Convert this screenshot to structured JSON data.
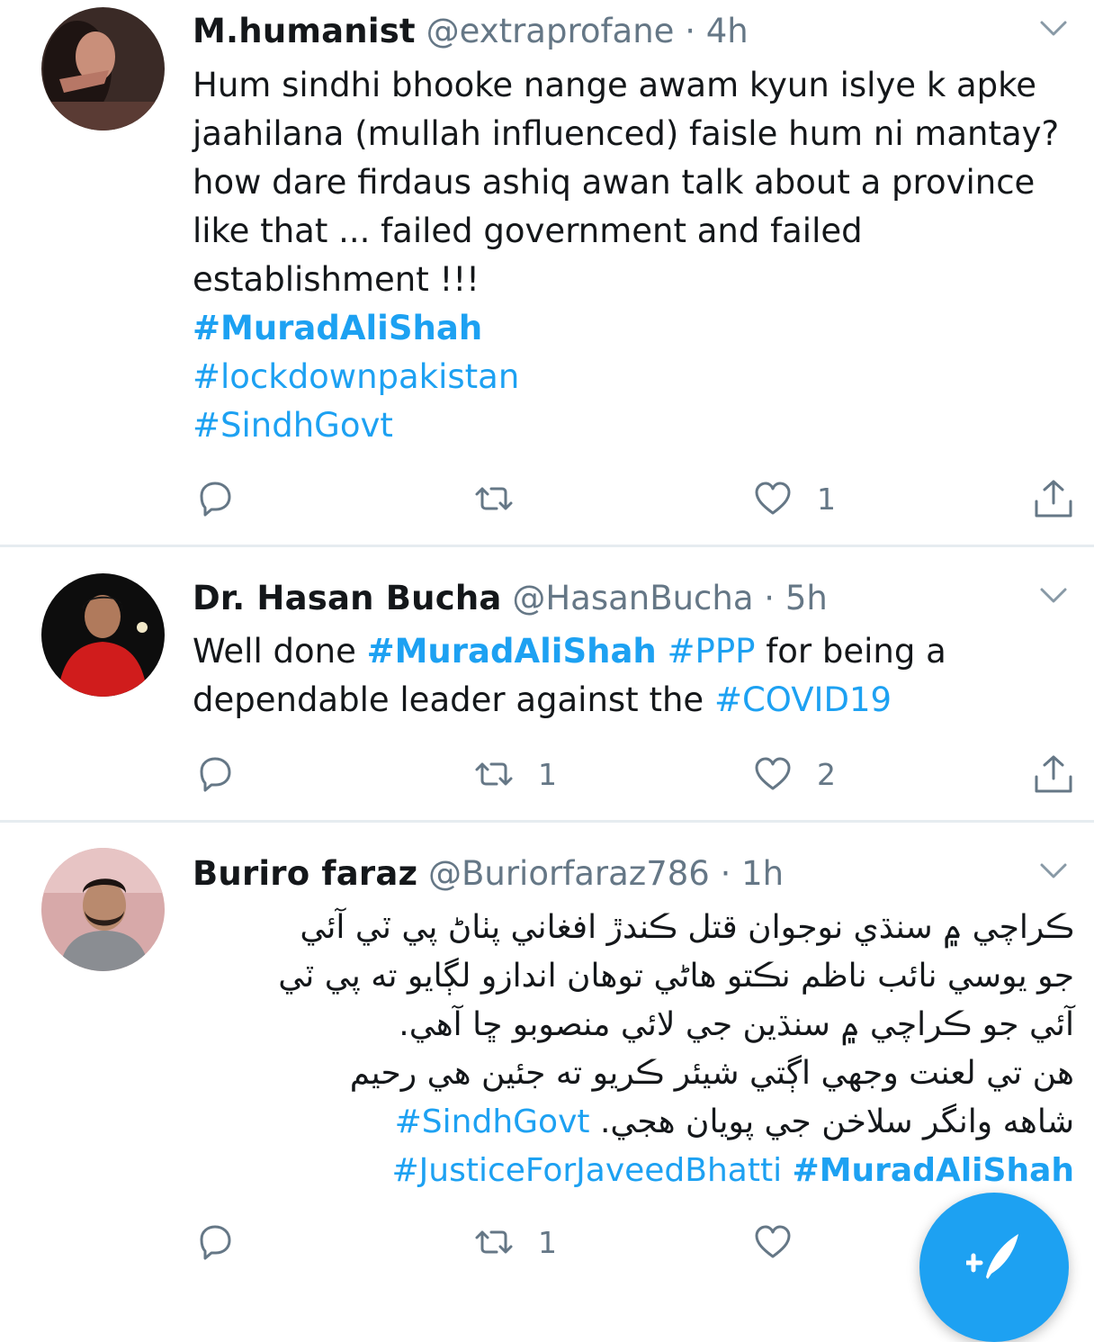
{
  "tweets": [
    {
      "name": "M.humanist",
      "handle": "@extraprofane",
      "time": "4h",
      "lines": [
        "Hum sindhi bhooke nange awam kyun islye k apke",
        "jaahilana (mullah influenced) faisle hum ni mantay?",
        "how dare firdaus ashiq awan talk about a province",
        "like that ... failed government and failed",
        "establishment !!!"
      ],
      "hashtags": [
        "#MuradAliShah",
        "#lockdownpakistan",
        "#SindhGovt"
      ],
      "retweets": "",
      "likes": "1"
    },
    {
      "name": "Dr. Hasan Bucha",
      "handle": "@HasanBucha",
      "time": "5h",
      "text_pre": "Well done ",
      "tag1": "#MuradAliShah",
      "tag2": "#PPP",
      "text_mid": " for being a",
      "text_line2": "dependable leader against the ",
      "tag3": "#COVID19",
      "retweets": "1",
      "likes": "2"
    },
    {
      "name": "Buriro faraz",
      "handle": "@Buriorfaraz786",
      "time": "1h",
      "lines": [
        "ڪراچي ۾ سنڌي نوجوان قتل ڪندڙ افغاني پٺاڻ پي ٽي آئي",
        "جو يوسي نائب ناظم نڪتو هاڻي توهان اندازو لڳايو ته پي ٽي",
        "آئي جو ڪراچي ۾ سنڌين جي لائي منصوبو ڇا آهي.",
        "هن تي لعنت وجهي اڳتي شيئر ڪريو ته جئين هي رحيم",
        "شاهه وانگر سلاخن جي پويان هجي."
      ],
      "tag_sindh": "#SindhGovt",
      "tag_justice": "#JusticeForJaveedBhatti",
      "tag_murad": "#MuradAliShah",
      "retweets": "1",
      "likes": ""
    }
  ],
  "icons": {
    "reply": "reply-icon",
    "retweet": "retweet-icon",
    "like": "heart-icon",
    "share": "share-icon",
    "caret": "chevron-down-icon",
    "compose": "compose-tweet-icon"
  },
  "colors": {
    "link": "#1da1f2",
    "text": "#14171a",
    "secondary": "#657786",
    "divider": "#e6ecf0"
  }
}
